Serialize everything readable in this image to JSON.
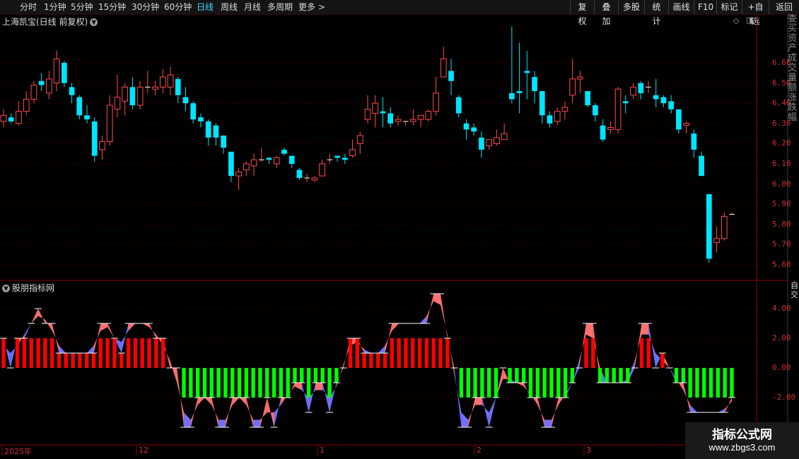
{
  "toolbar": {
    "periods": [
      {
        "label": "分时",
        "x": 0
      },
      {
        "label": "1分钟",
        "x": 0
      },
      {
        "label": "5分钟",
        "x": 0
      },
      {
        "label": "15分钟",
        "x": 0
      },
      {
        "label": "30分钟",
        "x": 0
      },
      {
        "label": "60分钟",
        "x": 0
      },
      {
        "label": "日线",
        "x": 0
      },
      {
        "label": "周线",
        "x": 0
      },
      {
        "label": "月线",
        "x": 0
      },
      {
        "label": "多周期",
        "x": 0
      },
      {
        "label": "更多",
        "x": 0
      }
    ],
    "more_chevron": ">",
    "active_period": "日线",
    "actions": [
      "复权",
      "叠加",
      "多股",
      "统计",
      "画线",
      "F10",
      "标记",
      "+自选",
      "返回"
    ]
  },
  "price_panel": {
    "title": "上海凯宝(日线 前复权)",
    "y_labels": [
      "6.60",
      "6.50",
      "6.40",
      "6.30",
      "6.20",
      "6.10",
      "6.00",
      "5.90",
      "5.80",
      "5.70",
      "5.60"
    ]
  },
  "indicator_panel": {
    "title": "股朋指标网",
    "y_labels": [
      "4.00",
      "2.00",
      "0.00",
      "-2.00"
    ]
  },
  "x_axis": {
    "labels": [
      "2025年",
      "12",
      "1",
      "2",
      "3"
    ]
  },
  "right_strip_text": "委买资产成交量额涨跌幅",
  "right_strip_lower": "自交",
  "watermark": {
    "title": "指标公式网",
    "url": "www.zbgs3.com"
  },
  "colors": {
    "up": "#ff4d4d",
    "down": "#00e5ff",
    "grid": "#5a0000",
    "fill_red": "#ff7070",
    "fill_blue": "#7070ff",
    "bar_red": "#ff0000",
    "bar_green": "#00ff00"
  },
  "chart_data": [
    {
      "type": "candlestick",
      "title": "上海凯宝(日线 前复权)",
      "ylim": [
        5.58,
        6.7
      ],
      "candles": [
        [
          6.31,
          6.34,
          6.28,
          6.37
        ],
        [
          6.33,
          6.31,
          6.3,
          6.35
        ],
        [
          6.3,
          6.36,
          6.29,
          6.41
        ],
        [
          6.36,
          6.42,
          6.34,
          6.46
        ],
        [
          6.42,
          6.49,
          6.4,
          6.51
        ],
        [
          6.51,
          6.49,
          6.46,
          6.55
        ],
        [
          6.45,
          6.52,
          6.42,
          6.56
        ],
        [
          6.5,
          6.62,
          6.46,
          6.66
        ],
        [
          6.6,
          6.5,
          6.48,
          6.61
        ],
        [
          6.48,
          6.44,
          6.4,
          6.5
        ],
        [
          6.43,
          6.34,
          6.32,
          6.44
        ],
        [
          6.34,
          6.32,
          6.3,
          6.39
        ],
        [
          6.31,
          6.14,
          6.11,
          6.33
        ],
        [
          6.17,
          6.21,
          6.12,
          6.24
        ],
        [
          6.21,
          6.39,
          6.19,
          6.44
        ],
        [
          6.37,
          6.43,
          6.33,
          6.54
        ],
        [
          6.41,
          6.48,
          6.34,
          6.5
        ],
        [
          6.48,
          6.39,
          6.37,
          6.53
        ],
        [
          6.39,
          6.48,
          6.37,
          6.51
        ],
        [
          6.48,
          6.48,
          6.45,
          6.56
        ],
        [
          6.47,
          6.48,
          6.44,
          6.51
        ],
        [
          6.48,
          6.53,
          6.45,
          6.57
        ],
        [
          6.48,
          6.54,
          6.44,
          6.58
        ],
        [
          6.52,
          6.44,
          6.4,
          6.53
        ],
        [
          6.43,
          6.4,
          6.36,
          6.48
        ],
        [
          6.4,
          6.32,
          6.3,
          6.41
        ],
        [
          6.33,
          6.31,
          6.28,
          6.35
        ],
        [
          6.31,
          6.23,
          6.19,
          6.32
        ],
        [
          6.29,
          6.23,
          6.19,
          6.3
        ],
        [
          6.24,
          6.18,
          6.15,
          6.24
        ],
        [
          6.16,
          6.04,
          6.01,
          6.16
        ],
        [
          6.04,
          6.06,
          5.97,
          6.08
        ],
        [
          6.07,
          6.1,
          6.04,
          6.11
        ],
        [
          6.09,
          6.12,
          6.04,
          6.15
        ],
        [
          6.12,
          6.12,
          6.11,
          6.18
        ],
        [
          6.13,
          6.12,
          6.1,
          6.13
        ],
        [
          6.1,
          6.13,
          6.08,
          6.14
        ],
        [
          6.17,
          6.15,
          6.14,
          6.18
        ],
        [
          6.14,
          6.1,
          6.08,
          6.14
        ],
        [
          6.07,
          6.03,
          6.02,
          6.08
        ],
        [
          6.03,
          6.03,
          6.01,
          6.05
        ],
        [
          6.02,
          6.03,
          6.01,
          6.04
        ],
        [
          6.04,
          6.1,
          6.04,
          6.12
        ],
        [
          6.12,
          6.12,
          6.1,
          6.15
        ],
        [
          6.14,
          6.13,
          6.11,
          6.14
        ],
        [
          6.13,
          6.12,
          6.1,
          6.15
        ],
        [
          6.14,
          6.17,
          6.13,
          6.22
        ],
        [
          6.2,
          6.24,
          6.15,
          6.26
        ],
        [
          6.32,
          6.37,
          6.3,
          6.44
        ],
        [
          6.35,
          6.4,
          6.28,
          6.44
        ],
        [
          6.36,
          6.35,
          6.28,
          6.43
        ],
        [
          6.35,
          6.3,
          6.28,
          6.38
        ],
        [
          6.31,
          6.32,
          6.29,
          6.34
        ],
        [
          6.31,
          6.31,
          6.29,
          6.31
        ],
        [
          6.31,
          6.32,
          6.29,
          6.37
        ],
        [
          6.32,
          6.34,
          6.28,
          6.34
        ],
        [
          6.32,
          6.36,
          6.31,
          6.37
        ],
        [
          6.36,
          6.45,
          6.34,
          6.53
        ],
        [
          6.53,
          6.62,
          6.53,
          6.68
        ],
        [
          6.56,
          6.51,
          6.44,
          6.62
        ],
        [
          6.43,
          6.35,
          6.33,
          6.44
        ],
        [
          6.3,
          6.27,
          6.22,
          6.32
        ],
        [
          6.28,
          6.26,
          6.24,
          6.3
        ],
        [
          6.23,
          6.17,
          6.13,
          6.26
        ],
        [
          6.19,
          6.22,
          6.17,
          6.22
        ],
        [
          6.2,
          6.23,
          6.19,
          6.27
        ],
        [
          6.22,
          6.25,
          6.22,
          6.3
        ],
        [
          6.45,
          6.42,
          6.4,
          6.78
        ],
        [
          6.46,
          6.45,
          6.35,
          6.7
        ],
        [
          6.56,
          6.55,
          6.42,
          6.66
        ],
        [
          6.53,
          6.46,
          6.4,
          6.56
        ],
        [
          6.46,
          6.34,
          6.3,
          6.46
        ],
        [
          6.34,
          6.3,
          6.28,
          6.36
        ],
        [
          6.31,
          6.36,
          6.29,
          6.38
        ],
        [
          6.36,
          6.38,
          6.32,
          6.41
        ],
        [
          6.44,
          6.52,
          6.4,
          6.62
        ],
        [
          6.52,
          6.53,
          6.45,
          6.56
        ],
        [
          6.46,
          6.39,
          6.38,
          6.46
        ],
        [
          6.39,
          6.34,
          6.31,
          6.4
        ],
        [
          6.29,
          6.22,
          6.21,
          6.32
        ],
        [
          6.27,
          6.28,
          6.25,
          6.31
        ],
        [
          6.27,
          6.47,
          6.25,
          6.48
        ],
        [
          6.41,
          6.4,
          6.35,
          6.44
        ],
        [
          6.44,
          6.48,
          6.42,
          6.5
        ],
        [
          6.5,
          6.45,
          6.42,
          6.51
        ],
        [
          6.48,
          6.48,
          6.45,
          6.51
        ],
        [
          6.44,
          6.42,
          6.38,
          6.52
        ],
        [
          6.43,
          6.4,
          6.38,
          6.44
        ],
        [
          6.41,
          6.37,
          6.35,
          6.44
        ],
        [
          6.37,
          6.27,
          6.25,
          6.37
        ],
        [
          6.29,
          6.3,
          6.25,
          6.31
        ],
        [
          6.25,
          6.17,
          6.13,
          6.27
        ],
        [
          6.14,
          6.04,
          6.04,
          6.16
        ],
        [
          5.95,
          5.63,
          5.61,
          5.95
        ],
        [
          5.71,
          5.73,
          5.66,
          5.79
        ],
        [
          5.73,
          5.84,
          5.72,
          5.86
        ],
        [
          5.85,
          5.85,
          5.85,
          5.86
        ]
      ]
    },
    {
      "type": "area",
      "title": "股朋指标网",
      "ylim": [
        -3.3,
        5.0
      ],
      "series": [
        {
          "values": [
            2,
            0,
            2,
            2,
            3,
            4,
            3,
            3,
            1,
            1,
            1,
            1,
            1,
            1,
            3,
            3,
            2,
            1,
            3,
            3,
            3,
            3,
            2,
            2,
            0,
            0,
            -4,
            -4,
            -2,
            -2,
            -2,
            -4,
            -4,
            -2,
            -2,
            -2,
            -4,
            -4,
            -2,
            -4,
            -2,
            -2,
            -1,
            -1,
            -3,
            -1,
            -1,
            -3,
            -1,
            0,
            2,
            2,
            1,
            1,
            1,
            1,
            3,
            3,
            3,
            3,
            3,
            3,
            5,
            5,
            2,
            0,
            -4,
            -4,
            -2,
            -2,
            -4,
            -2,
            0,
            -1,
            -1,
            -1,
            -2,
            -2,
            -4,
            -4,
            -2,
            -2,
            -1,
            0,
            3,
            3,
            -1,
            -1,
            -1,
            -1,
            -1,
            0,
            3,
            3,
            0,
            1,
            0,
            -1,
            -1,
            -3,
            -3,
            -3,
            -3,
            -3,
            -3,
            -2
          ],
          "bars": "color"
        }
      ]
    }
  ]
}
